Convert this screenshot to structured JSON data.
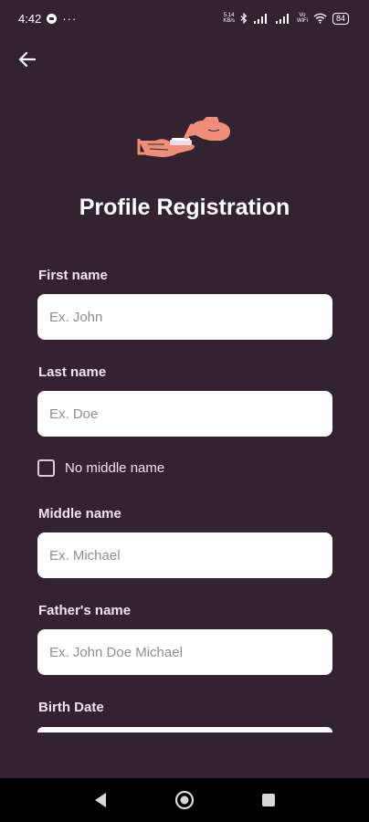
{
  "status_bar": {
    "time": "4:42",
    "more": "···",
    "net_speed_top": "5.14",
    "net_speed_bottom": "KB/s",
    "volte_top": "Vo",
    "volte_bottom": "WiFi",
    "battery": "84"
  },
  "header": {
    "title": "Profile Registration"
  },
  "form": {
    "first_name": {
      "label": "First name",
      "placeholder": "Ex. John"
    },
    "last_name": {
      "label": "Last name",
      "placeholder": "Ex. Doe"
    },
    "no_middle_name": {
      "label": "No middle name",
      "checked": false
    },
    "middle_name": {
      "label": "Middle name",
      "placeholder": "Ex. Michael"
    },
    "fathers_name": {
      "label": "Father's name",
      "placeholder": "Ex. John Doe Michael"
    },
    "birth_date": {
      "label": "Birth Date"
    }
  },
  "colors": {
    "background": "#33222f",
    "accent": "#f08f78",
    "input_background": "#ffffff",
    "nav_bar": "#000000"
  }
}
